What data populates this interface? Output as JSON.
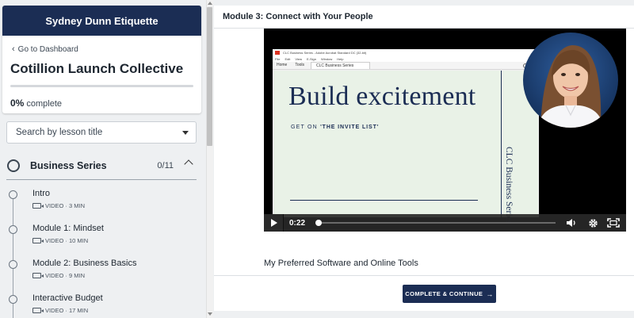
{
  "sidebar": {
    "brand": "Sydney Dunn Etiquette",
    "back_link": "Go to Dashboard",
    "course_title": "Cotillion Launch Collective",
    "progress_percent_label": "0%",
    "progress_suffix": "complete",
    "progress_value": 0,
    "search_placeholder": "Search by lesson title",
    "section": {
      "title": "Business Series",
      "count": "0/11"
    },
    "lessons": [
      {
        "title": "Intro",
        "meta": "VIDEO · 3 MIN"
      },
      {
        "title": "Module 1: Mindset",
        "meta": "VIDEO · 10 MIN"
      },
      {
        "title": "Module 2: Business Basics",
        "meta": "VIDEO · 9 MIN"
      },
      {
        "title": "Interactive Budget",
        "meta": "VIDEO · 17 MIN"
      }
    ]
  },
  "main": {
    "module_title": "Module 3: Connect with Your People",
    "video": {
      "app_title": "CLC Business Series - Adobe Acrobat Standard DC (32-bit)",
      "app_menu": [
        "File",
        "Edit",
        "View",
        "E-Sign",
        "Window",
        "Help"
      ],
      "app_tabs": [
        "Home",
        "Tools",
        "CLC Business Series"
      ],
      "slide_headline": "Build excitement",
      "slide_sub_prefix": "GET ON",
      "slide_sub_emphasis": "'THE INVITE LIST'",
      "slide_vertical": "CLC Business Series",
      "time": "0:22"
    },
    "resources_link": "My Preferred Software and Online Tools",
    "complete_button": "COMPLETE & CONTINUE"
  },
  "colors": {
    "brand_navy": "#1b2d54",
    "slide_bg": "#e9f2e7",
    "page_bg": "#eef0f2"
  }
}
